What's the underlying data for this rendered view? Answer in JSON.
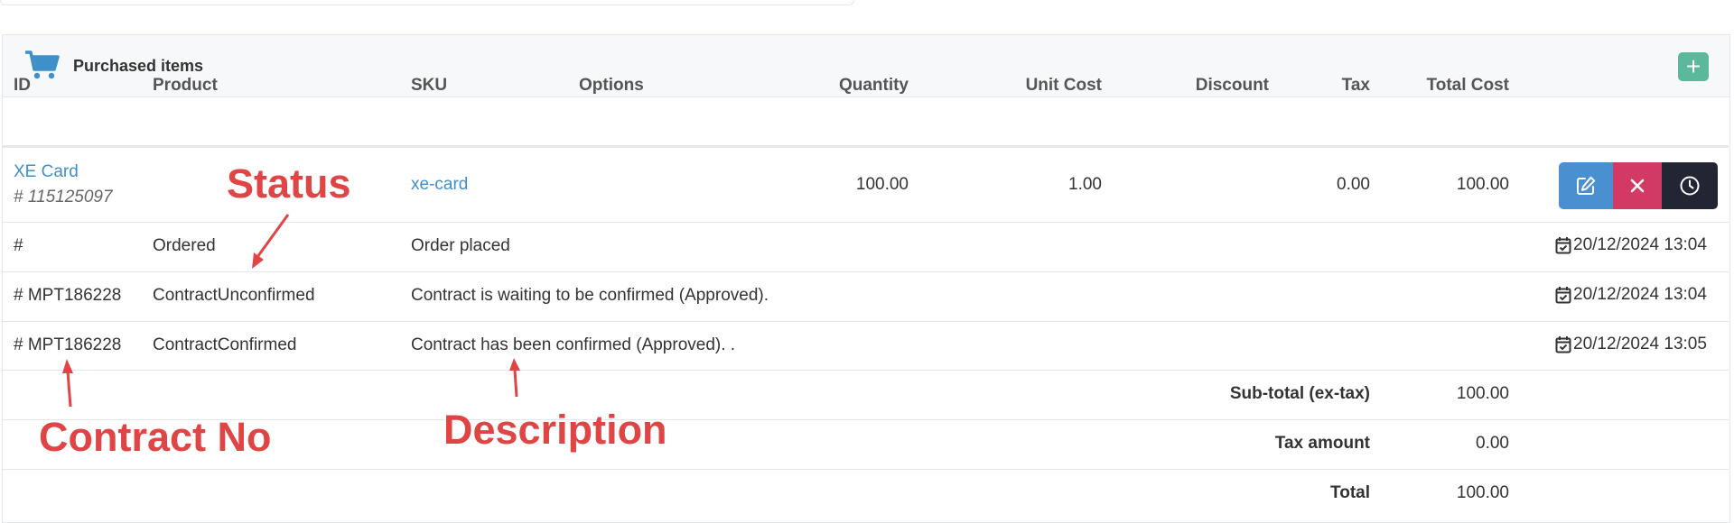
{
  "panel": {
    "title": "Purchased items",
    "add_button_label": "+"
  },
  "table": {
    "headers": {
      "id": "ID",
      "product": "Product",
      "sku": "SKU",
      "options": "Options",
      "quantity": "Quantity",
      "unit_cost": "Unit Cost",
      "discount": "Discount",
      "tax": "Tax",
      "total_cost": "Total Cost"
    },
    "item": {
      "name": "XE Card",
      "number": "# 115125097",
      "sku": "xe-card",
      "quantity": "100.00",
      "unit_cost": "1.00",
      "tax": "0.00",
      "total_cost": "100.00"
    },
    "status_rows": [
      {
        "contract": "#",
        "status": "Ordered",
        "description": "Order placed",
        "date": "20/12/2024 13:04"
      },
      {
        "contract": "# MPT186228",
        "status": "ContractUnconfirmed",
        "description": "Contract is waiting to be confirmed (Approved).",
        "date": "20/12/2024 13:04"
      },
      {
        "contract": "# MPT186228",
        "status": "ContractConfirmed",
        "description": "Contract has been confirmed (Approved). .",
        "date": "20/12/2024 13:05"
      }
    ],
    "totals": {
      "subtotal_label": "Sub-total (ex-tax)",
      "subtotal_value": "100.00",
      "tax_label": "Tax amount",
      "tax_value": "0.00",
      "total_label": "Total",
      "total_value": "100.00"
    }
  },
  "annotations": {
    "status": "Status",
    "contract_no": "Contract No",
    "description": "Description"
  },
  "colors": {
    "link": "#3f8fc9",
    "add_button": "#5cb89a",
    "edit_button": "#4a8fd0",
    "delete_button": "#d23a63",
    "history_button": "#222634",
    "annotation": "#e04545"
  },
  "icons": {
    "panel": "cart-icon",
    "add": "plus-icon",
    "edit": "edit-icon",
    "delete": "close-icon",
    "history": "clock-icon",
    "date": "calendar-check-icon"
  }
}
